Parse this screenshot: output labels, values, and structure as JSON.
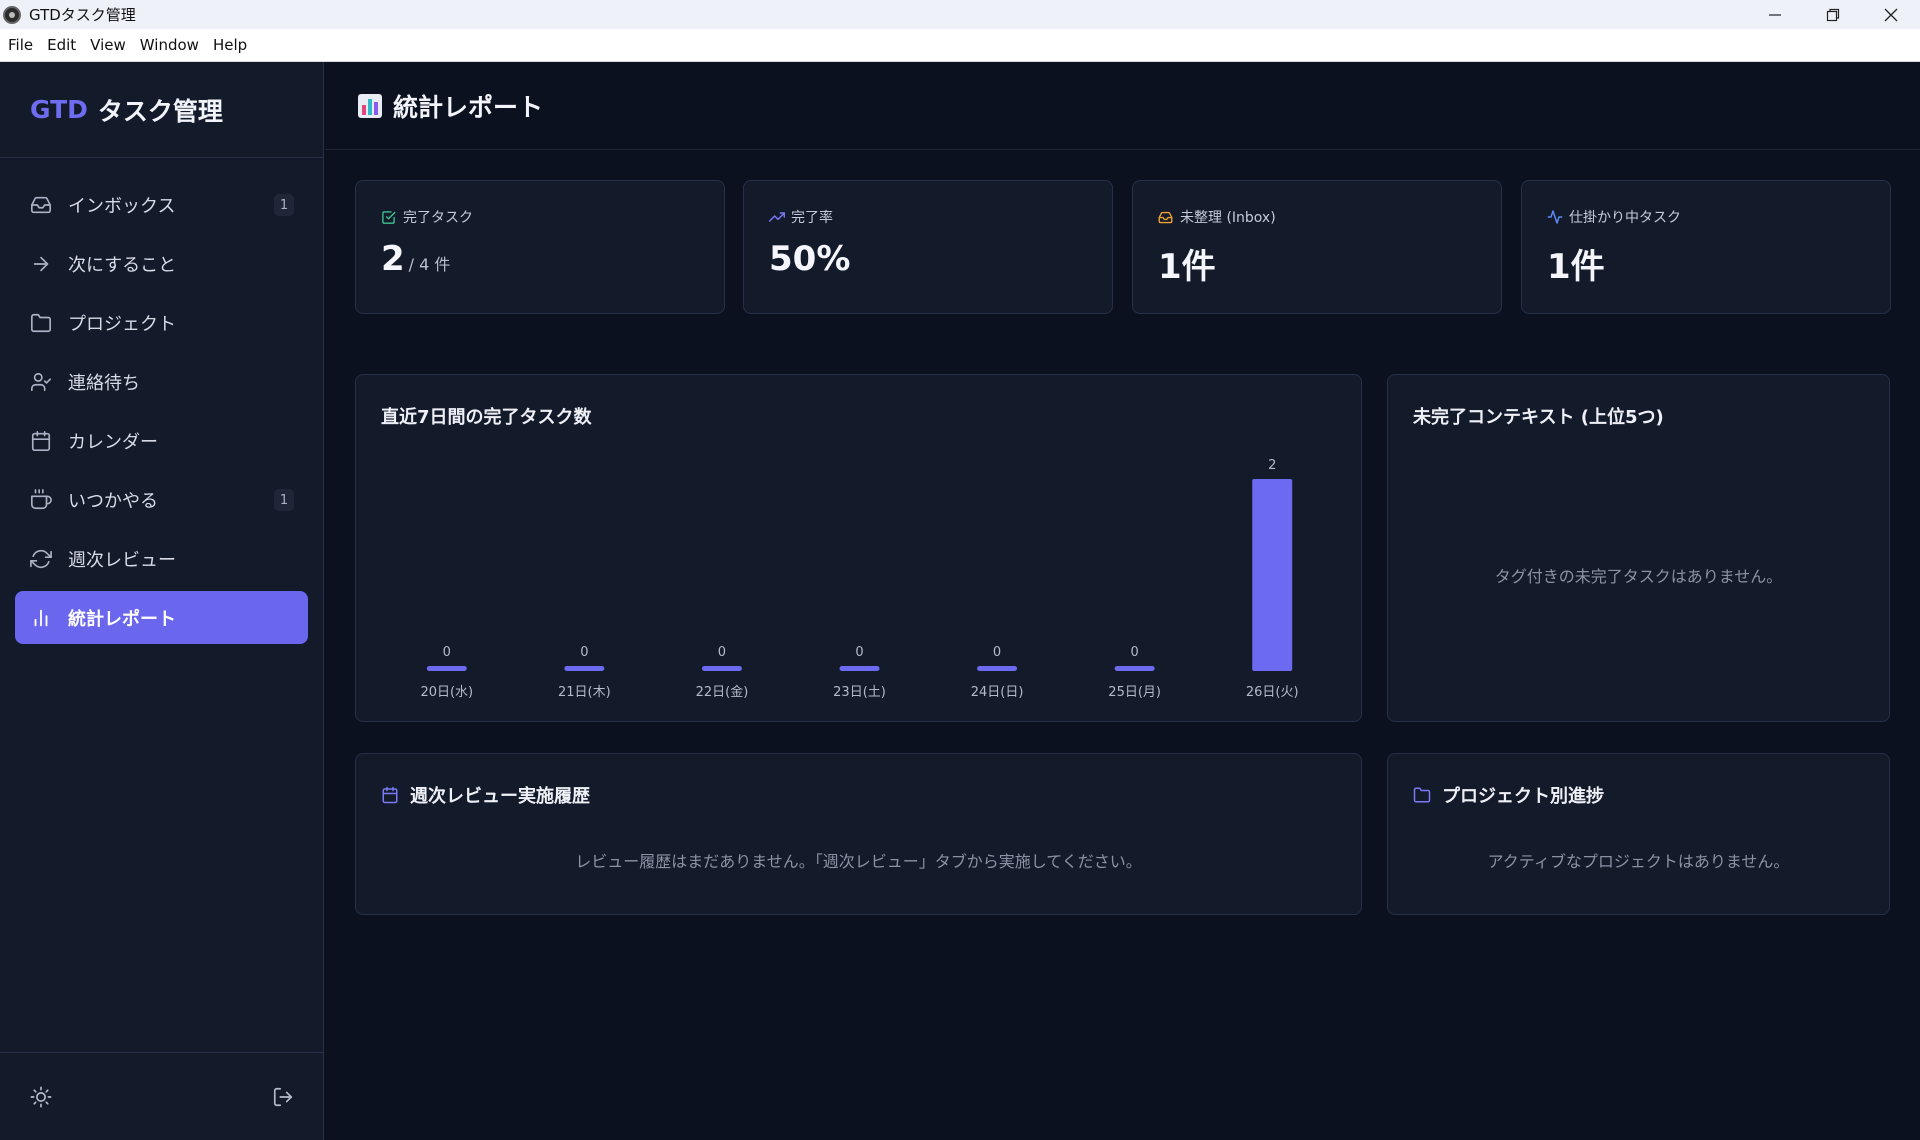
{
  "window": {
    "title": "GTDタスク管理",
    "controls": {
      "minimize": "—",
      "restore": "❐",
      "close": "✕"
    }
  },
  "menubar": [
    "File",
    "Edit",
    "View",
    "Window",
    "Help"
  ],
  "sidebar": {
    "brand_prefix": "GTD",
    "brand_name": "タスク管理",
    "items": [
      {
        "label": "インボックス",
        "icon": "inbox-icon",
        "count": "1"
      },
      {
        "label": "次にすること",
        "icon": "arrow-right-icon",
        "count": ""
      },
      {
        "label": "プロジェクト",
        "icon": "folder-icon",
        "count": ""
      },
      {
        "label": "連絡待ち",
        "icon": "user-check-icon",
        "count": ""
      },
      {
        "label": "カレンダー",
        "icon": "calendar-icon",
        "count": ""
      },
      {
        "label": "いつかやる",
        "icon": "coffee-icon",
        "count": "1"
      },
      {
        "label": "週次レビュー",
        "icon": "refresh-icon",
        "count": ""
      },
      {
        "label": "統計レポート",
        "icon": "bar-chart-icon",
        "count": "",
        "active": true
      }
    ],
    "bottom": {
      "theme_icon": "sun-icon",
      "logout_icon": "logout-icon"
    }
  },
  "header": {
    "title": "統計レポート",
    "icon": "chart-emoji-icon"
  },
  "stats": [
    {
      "label": "完了タスク",
      "value": "2",
      "sub": "/ 4 件",
      "icon": "check-square-icon",
      "color": "#3ec28f"
    },
    {
      "label": "完了率",
      "value": "50%",
      "sub": "",
      "icon": "trending-up-icon",
      "color": "#7b79f5"
    },
    {
      "label": "未整理 (Inbox)",
      "value": "1件",
      "sub": "",
      "icon": "inbox-icon",
      "color": "#f0a030"
    },
    {
      "label": "仕掛かり中タスク",
      "value": "1件",
      "sub": "",
      "icon": "activity-icon",
      "color": "#5b8cf5"
    }
  ],
  "panels": {
    "chart": {
      "title": "直近7日間の完了タスク数"
    },
    "contexts": {
      "title": "未完了コンテキスト (上位5つ)",
      "empty": "タグ付きの未完了タスクはありません。"
    },
    "reviews": {
      "title": "週次レビュー実施履歴",
      "empty": "レビュー履歴はまだありません。「週次レビュー」タブから実施してください。"
    },
    "projects": {
      "title": "プロジェクト別進捗",
      "empty": "アクティブなプロジェクトはありません。"
    }
  },
  "chart_data": {
    "type": "bar",
    "title": "直近7日間の完了タスク数",
    "categories": [
      "20日(水)",
      "21日(木)",
      "22日(金)",
      "23日(土)",
      "24日(日)",
      "25日(月)",
      "26日(火)"
    ],
    "values": [
      0,
      0,
      0,
      0,
      0,
      0,
      2
    ],
    "ylim": [
      0,
      2
    ],
    "grid": false,
    "color": "#6c6af0"
  }
}
